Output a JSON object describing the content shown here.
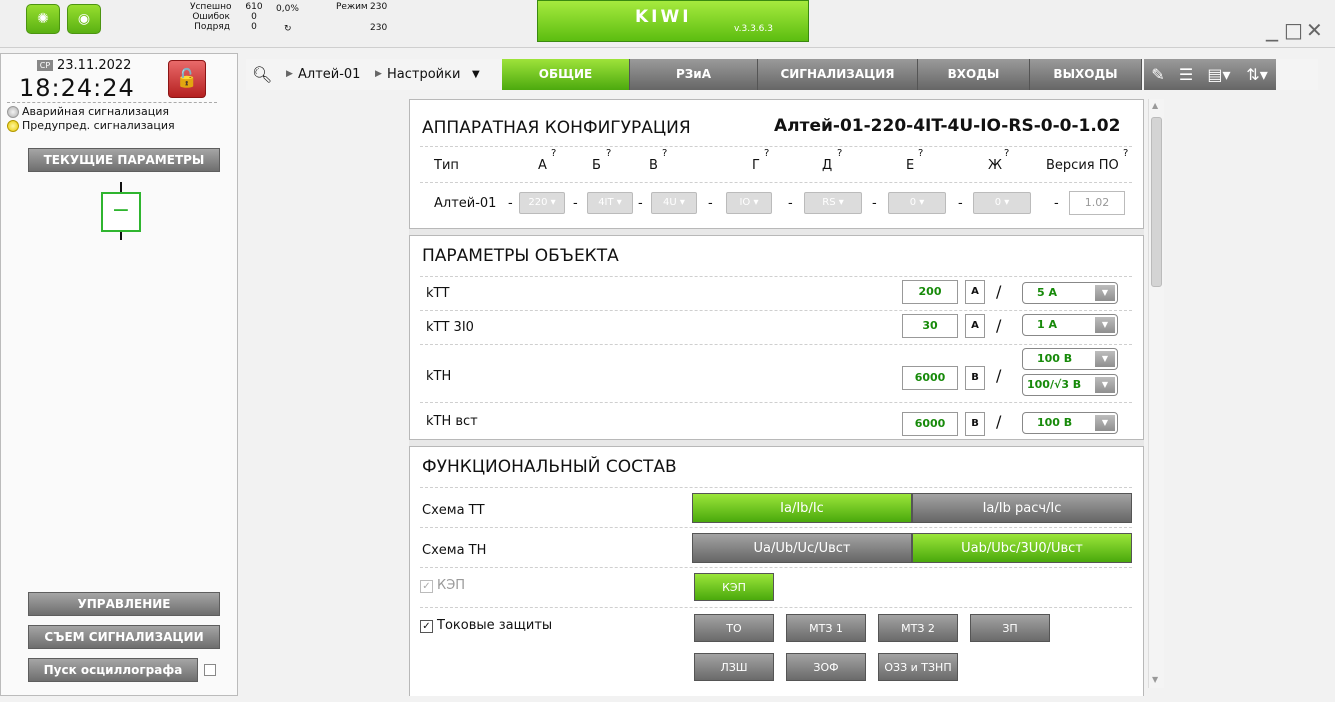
{
  "status": {
    "labels": [
      "Успешно",
      "Ошибок",
      "Подряд"
    ],
    "values": [
      "610",
      "0",
      "0"
    ],
    "percent": "0,0%",
    "mode_label": "Режим",
    "mode_value1": "230",
    "mode_value2": "230"
  },
  "app": {
    "title": "KIWI",
    "version": "v.3.3.6.3"
  },
  "left": {
    "weekday": "СР",
    "date": "23.11.2022",
    "time": "18:24:24",
    "alarms": [
      "Аварийная сигнализация",
      "Предупред. сигнализация"
    ],
    "current_params": "ТЕКУЩИЕ ПАРАМЕТРЫ",
    "control": "УПРАВЛЕНИЕ",
    "reset_alarm": "СЪЕМ СИГНАЛИЗАЦИИ",
    "osc_start": "Пуск осциллографа"
  },
  "toolbar": {
    "crumbs": [
      "Алтей-01",
      "Настройки"
    ],
    "tabs": [
      "ОБЩИЕ",
      "РЗиА",
      "СИГНАЛИЗАЦИЯ",
      "ВХОДЫ",
      "ВЫХОДЫ"
    ],
    "active_tab": "ОБЩИЕ"
  },
  "hw": {
    "title": "АППАРАТНАЯ КОНФИГУРАЦИЯ",
    "model": "Алтей-01-220-4IT-4U-IO-RS-0-0-1.02",
    "cols": [
      "Тип",
      "А",
      "Б",
      "В",
      "Г",
      "Д",
      "Е",
      "Ж",
      "Версия ПО"
    ],
    "help_mark": "?",
    "type_value": "Алтей-01",
    "dash": "-",
    "values": [
      "220",
      "4IT",
      "4U",
      "IO",
      "RS",
      "0",
      "0"
    ],
    "sw_version": "1.02"
  },
  "obj": {
    "title": "ПАРАМЕТРЫ ОБЪЕКТА",
    "slash": "/",
    "rows": [
      {
        "label": "kТТ",
        "value": "200",
        "unit": "А",
        "sel": "5 А"
      },
      {
        "label": "kТТ 3I0",
        "value": "30",
        "unit": "А",
        "sel": "1 А"
      },
      {
        "label": "kТН",
        "value": "6000",
        "unit": "В",
        "sel": "100 В",
        "sel2": "100/√3 В"
      },
      {
        "label": "kТН вст",
        "value": "6000",
        "unit": "В",
        "sel": "100 В"
      }
    ]
  },
  "func": {
    "title": "ФУНКЦИОНАЛЬНЫЙ СОСТАВ",
    "schema_tt": "Схема ТТ",
    "tt_opts": [
      "Ia/Ib/Ic",
      "Ia/Ib расч/Ic"
    ],
    "schema_tn": "Схема ТН",
    "tn_opts": [
      "Ua/Ub/Uc/Uвст",
      "Uab/Ubc/3U0/Uвст"
    ],
    "kep_label": "КЭП",
    "kep_btn": "КЭП",
    "current_prot": "Токовые защиты",
    "prot_buttons": [
      "ТО",
      "МТЗ 1",
      "МТЗ 2",
      "ЗП",
      "ЛЗШ",
      "ЗОФ",
      "ОЗЗ и ТЗНП"
    ]
  },
  "colors": {
    "accent": "#5cbd10",
    "gray": "#7a7a7a",
    "value_green": "#178a0a"
  }
}
